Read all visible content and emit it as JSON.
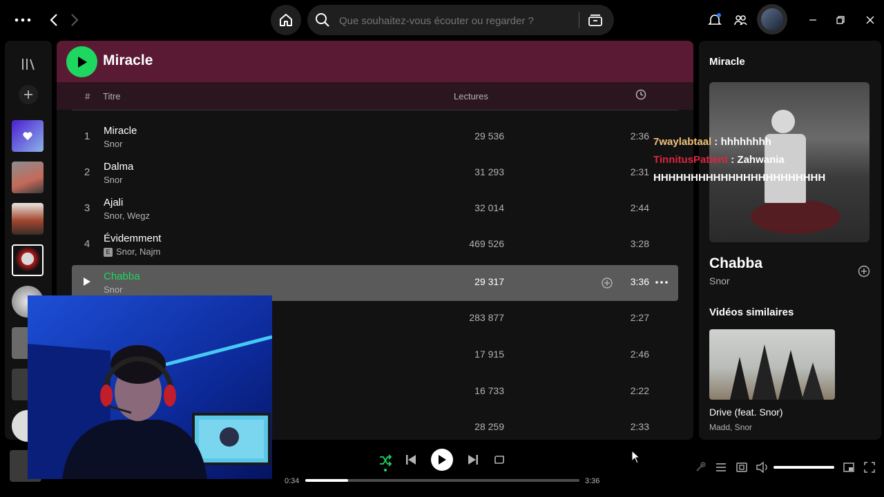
{
  "topbar": {
    "search_placeholder": "Que souhaitez-vous écouter ou regarder ?"
  },
  "main": {
    "title": "Miracle",
    "columns": {
      "num": "#",
      "title": "Titre",
      "plays": "Lectures"
    },
    "tracks": [
      {
        "num": "1",
        "title": "Miracle",
        "artist": "Snor",
        "plays": "29 536",
        "duration": "2:36"
      },
      {
        "num": "2",
        "title": "Dalma",
        "artist": "Snor",
        "plays": "31 293",
        "duration": "2:31"
      },
      {
        "num": "3",
        "title": "Ajali",
        "artist": "Snor, Wegz",
        "plays": "32 014",
        "duration": "2:44"
      },
      {
        "num": "4",
        "title": "Évidemment",
        "artist": "Snor, Najm",
        "explicit": "E",
        "plays": "469 526",
        "duration": "3:28"
      },
      {
        "num": "5",
        "title": "Chabba",
        "artist": "Snor",
        "plays": "29 317",
        "duration": "3:36"
      },
      {
        "num": "6",
        "title": "",
        "artist": "",
        "plays": "283 877",
        "duration": "2:27"
      },
      {
        "num": "7",
        "title": "",
        "artist": "",
        "plays": "17 915",
        "duration": "2:46"
      },
      {
        "num": "8",
        "title": "",
        "artist": "",
        "plays": "16 733",
        "duration": "2:22"
      },
      {
        "num": "9",
        "title": "",
        "artist": "",
        "plays": "28 259",
        "duration": "2:33"
      }
    ]
  },
  "right": {
    "heading": "Miracle",
    "now_title": "Chabba",
    "now_artist": "Snor",
    "similar_heading": "Vidéos similaires",
    "similar_title": "Drive (feat. Snor)",
    "similar_artist": "Madd, Snor"
  },
  "chat": [
    {
      "user": "7waylabtaal",
      "sep": " : ",
      "message": "hhhhhhhh",
      "color": "#f0c27a"
    },
    {
      "user": "TinnitusPatient",
      "sep": " : ",
      "message": "Zahwania",
      "color": "#e0253f"
    },
    {
      "user": "",
      "sep": "",
      "message": "HHHHHHHHHHHHHHHHHHHHHHH",
      "color": "#ffffff"
    }
  ],
  "player": {
    "elapsed": "0:34",
    "total": "3:36",
    "progress_fraction": 0.157,
    "volume_fraction": 1.0
  },
  "colors": {
    "accent": "#1ed760",
    "header": "#5a1a33",
    "panel": "#121212"
  },
  "icons": [
    "more-icon",
    "back-icon",
    "forward-icon",
    "home-icon",
    "search-icon",
    "browse-icon",
    "bell-icon",
    "friends-icon",
    "library-icon",
    "plus-icon",
    "clock-icon",
    "shuffle-icon",
    "previous-icon",
    "play-icon",
    "next-icon",
    "repeat-icon",
    "lyrics-icon",
    "queue-icon",
    "connect-device-icon",
    "volume-icon",
    "mini-player-icon",
    "fullscreen-icon"
  ]
}
